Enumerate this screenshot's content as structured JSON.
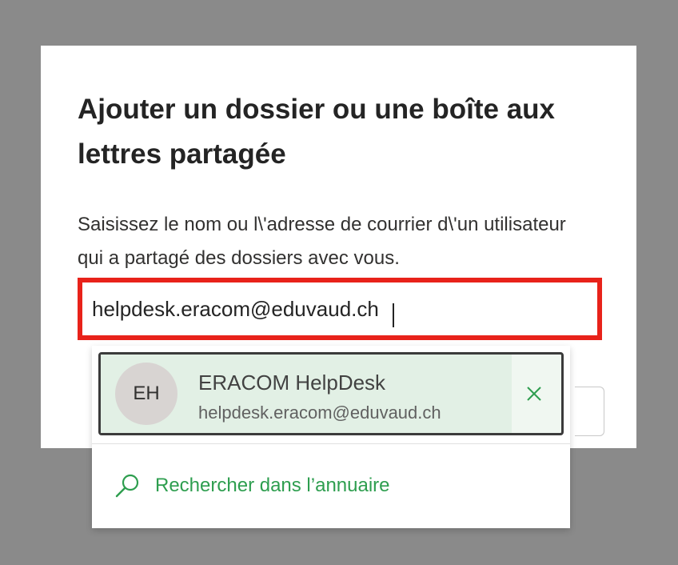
{
  "dialog": {
    "title": "Ajouter un dossier ou une boîte aux lettres partagée",
    "description": "Saisissez le nom ou l\\'adresse de courrier d\\'un utilisateur qui a partagé des dossiers avec vous.",
    "input_value": "helpdesk.eracom@eduvaud.ch",
    "highlight_color": "#e8221a"
  },
  "suggestion": {
    "initials": "EH",
    "name": "ERACOM HelpDesk",
    "email": "helpdesk.eracom@eduvaud.ch",
    "remove_icon": "close-icon",
    "background_color": "#e2f0e5"
  },
  "directory_search": {
    "label": "Rechercher dans l’annuaire",
    "icon": "search-icon",
    "accent_color": "#2e9e4f"
  }
}
